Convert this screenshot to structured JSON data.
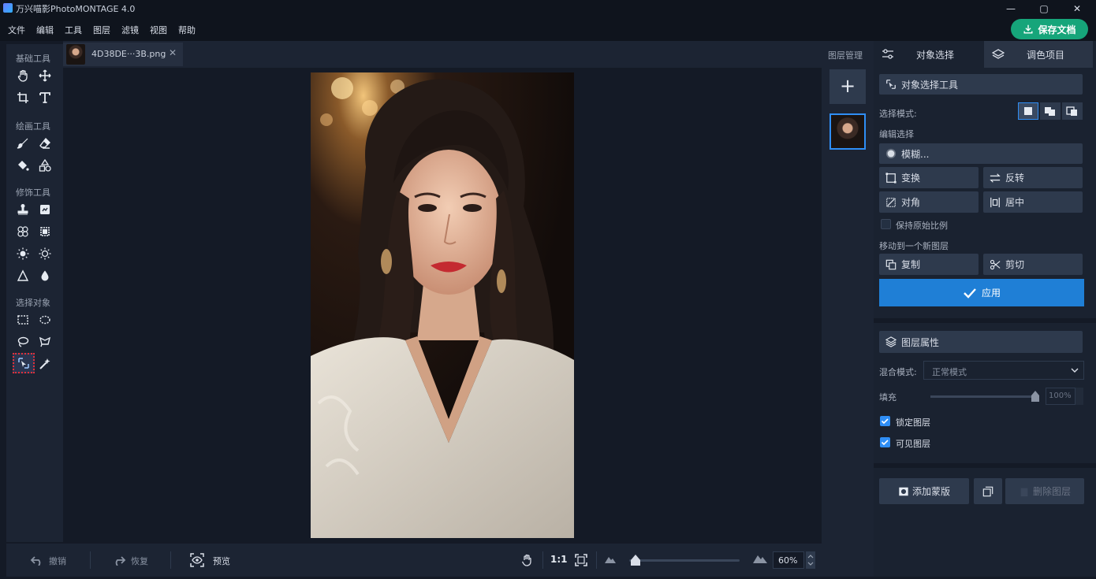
{
  "window": {
    "title": "万兴喵影PhotoMONTAGE 4.0",
    "minimize": "—",
    "maximize": "▢",
    "close": "✕"
  },
  "menu": [
    "文件",
    "编辑",
    "工具",
    "图层",
    "滤镜",
    "视图",
    "帮助"
  ],
  "save_button": "保存文档",
  "toolbox": {
    "groups": [
      "基础工具",
      "绘画工具",
      "修饰工具",
      "选择对象"
    ]
  },
  "document_tab": {
    "filename": "4D38DE···3B.png",
    "close": "✕"
  },
  "layers_column": {
    "title": "图层管理",
    "add": "+"
  },
  "bottom_bar": {
    "undo": "撤销",
    "redo": "恢复",
    "preview": "预览",
    "ratio": "1:1",
    "zoom": "60%",
    "zoom_fraction": 0.0
  },
  "right_panel": {
    "tabs": [
      "对象选择",
      "调色项目"
    ],
    "section_title": "对象选择工具",
    "select_mode_label": "选择模式:",
    "edit_selection_label": "编辑选择",
    "feather_button": "模糊...",
    "transform_buttons": [
      "变换",
      "反转",
      "对角",
      "居中"
    ],
    "keep_ratio_label": "保持原始比例",
    "move_to_layer_label": "移动到一个新图层",
    "copy_button": "复制",
    "cut_button": "剪切",
    "apply_button": "应用",
    "layer_props_title": "图层属性",
    "blend_mode_label": "混合模式:",
    "blend_mode_value": "正常模式",
    "fill_label": "填充",
    "fill_value": "100%",
    "lock_layer_label": "锁定图层",
    "visible_layer_label": "可见图层",
    "add_mask_button": "添加蒙版",
    "delete_layer_button": "删除图层"
  },
  "colors": {
    "accent": "#2f8ef5",
    "apply": "#1f7fd6",
    "save": "#16a57a"
  }
}
